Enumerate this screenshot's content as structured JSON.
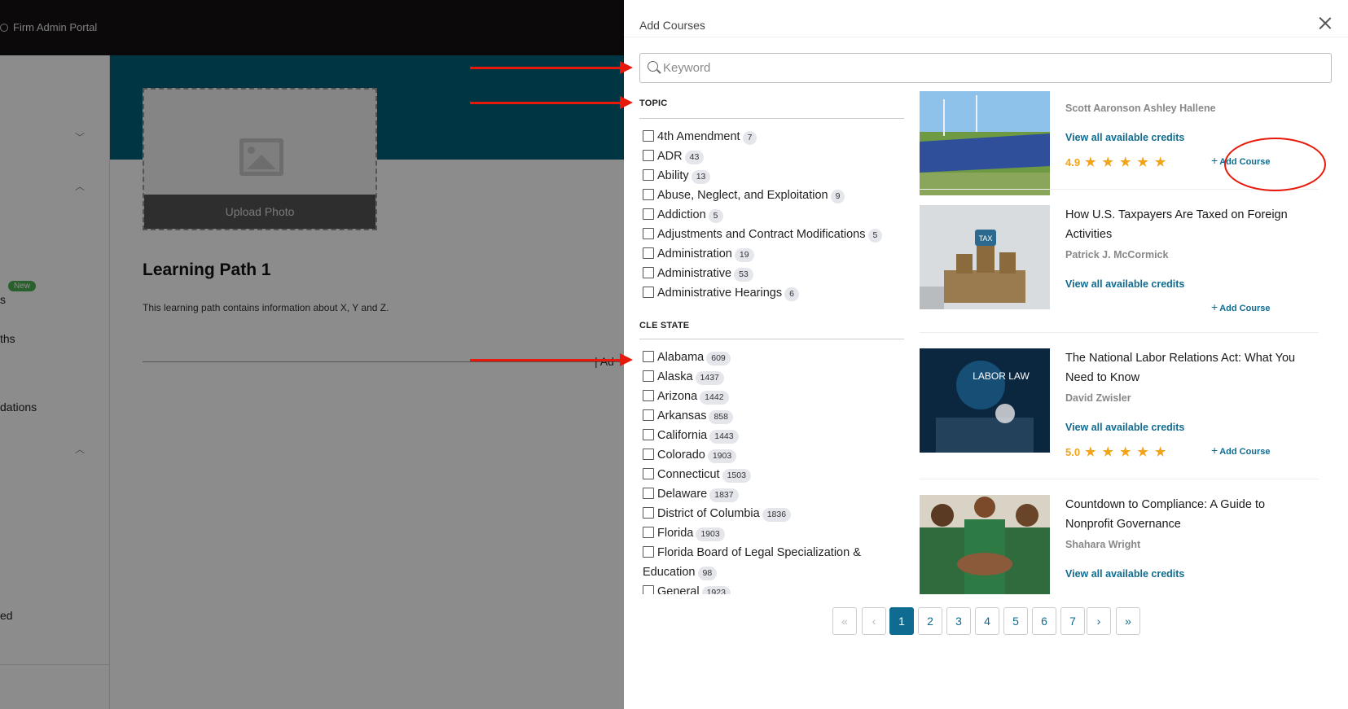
{
  "background": {
    "portal_title": "Firm Admin Portal",
    "sidebar": {
      "new_badge": "New",
      "item_s": "s",
      "item_ths": "ths",
      "item_dations": "dations",
      "item_ed": "ed"
    },
    "upload_photo": "Upload Photo",
    "learning_path_title": "Learning Path 1",
    "learning_path_desc": "This learning path contains information about X, Y and Z.",
    "partial_link": "Ad"
  },
  "drawer": {
    "title": "Add Courses",
    "search_placeholder": "Keyword"
  },
  "filters": {
    "topic": {
      "title": "TOPIC",
      "items": [
        {
          "label": "4th Amendment",
          "count": "7"
        },
        {
          "label": "ADR",
          "count": "43"
        },
        {
          "label": "Ability",
          "count": "13"
        },
        {
          "label": "Abuse, Neglect, and Exploitation",
          "count": "9"
        },
        {
          "label": "Addiction",
          "count": "5"
        },
        {
          "label": "Adjustments and Contract Modifications",
          "count": "5"
        },
        {
          "label": "Administration",
          "count": "19"
        },
        {
          "label": "Administrative",
          "count": "53"
        },
        {
          "label": "Administrative Hearings",
          "count": "6"
        }
      ]
    },
    "cle_state": {
      "title": "CLE STATE",
      "items": [
        {
          "label": "Alabama",
          "count": "609"
        },
        {
          "label": "Alaska",
          "count": "1437"
        },
        {
          "label": "Arizona",
          "count": "1442"
        },
        {
          "label": "Arkansas",
          "count": "858"
        },
        {
          "label": "California",
          "count": "1443"
        },
        {
          "label": "Colorado",
          "count": "1903"
        },
        {
          "label": "Connecticut",
          "count": "1503"
        },
        {
          "label": "Delaware",
          "count": "1837"
        },
        {
          "label": "District of Columbia",
          "count": "1836"
        },
        {
          "label": "Florida",
          "count": "1903"
        },
        {
          "label": "Florida Board of Legal Specialization & Education",
          "count": "98"
        },
        {
          "label": "General",
          "count": "1923"
        }
      ]
    }
  },
  "courses": [
    {
      "title": "",
      "authors": "Scott Aaronson   Ashley Hallene",
      "credits_link": "View all available credits",
      "rating": "4.9",
      "stars": "★★★★★",
      "add_label": "Add Course",
      "thumb": "solar-panels"
    },
    {
      "title": "How U.S. Taxpayers Are Taxed on Foreign Activities",
      "authors": "Patrick J. McCormick",
      "credits_link": "View all available credits",
      "add_label": "Add Course",
      "thumb": "tax-coins"
    },
    {
      "title": "The National Labor Relations Act: What You Need to Know",
      "authors": "David Zwisler",
      "credits_link": "View all available credits",
      "rating": "5.0",
      "stars": "★★★★★",
      "add_label": "Add Course",
      "thumb": "labor-law",
      "thumb_text": "LABOR LAW"
    },
    {
      "title": "Countdown to Compliance: A Guide to Nonprofit Governance",
      "authors": "Shahara Wright",
      "credits_link": "View all available credits",
      "thumb": "team-hands"
    }
  ],
  "pagination": {
    "first": "«",
    "prev": "‹",
    "pages": [
      "1",
      "2",
      "3",
      "4",
      "5",
      "6",
      "7"
    ],
    "active": "1",
    "next": "›",
    "last": "»"
  },
  "colors": {
    "accent": "#0f6b8f",
    "hero": "#00627a",
    "rating": "#f2a319",
    "annotation": "#e8190a"
  }
}
